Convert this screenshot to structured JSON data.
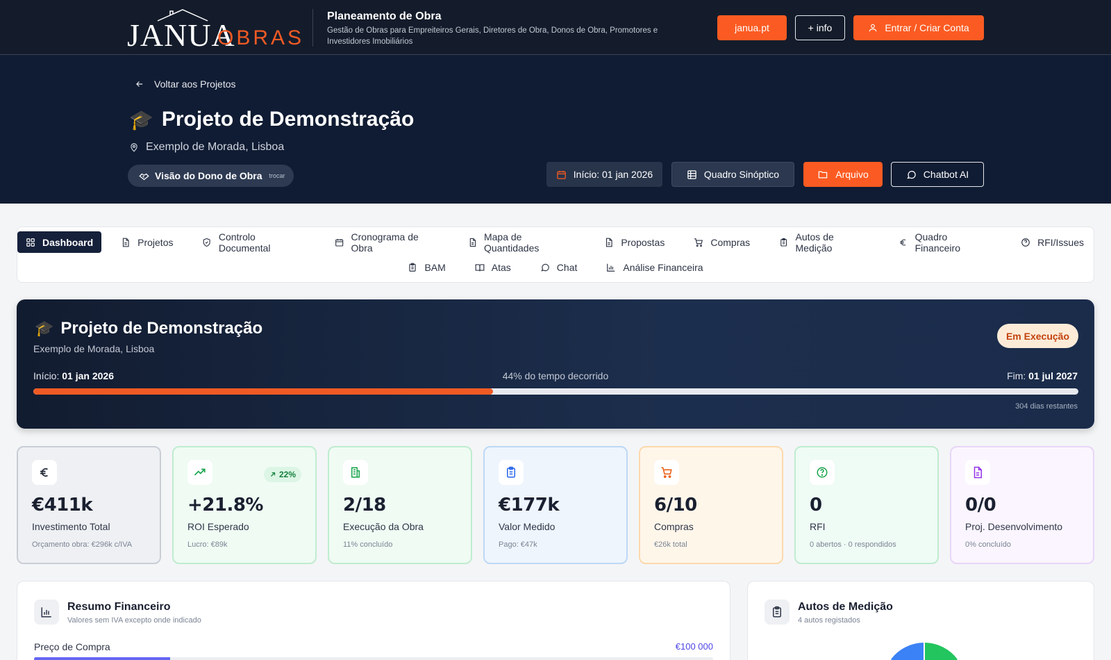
{
  "header": {
    "logo_main": "JANUA",
    "logo_sub": "OBRAS",
    "title": "Planeamento de Obra",
    "subtitle": "Gestão de Obras para Empreiteiros Gerais, Diretores de Obra, Donos de Obra, Promotores e Investidores Imobiliários",
    "btn_site": "janua.pt",
    "btn_info": "+ info",
    "btn_login": "Entrar / Criar Conta",
    "accent": "#fb5b22"
  },
  "hero": {
    "back": "Voltar aos Projetos",
    "emoji": "🎓",
    "title": "Projeto de Demonstração",
    "address": "Exemplo de Morada, Lisboa",
    "view_label": "Visão do Dono de Obra",
    "view_switch": "trocar",
    "start": "Início: 01 jan 2026",
    "quadro": "Quadro Sinóptico",
    "arquivo": "Arquivo",
    "chatbot": "Chatbot AI"
  },
  "nav": {
    "row1": [
      {
        "label": "Dashboard",
        "icon": "grid-icon",
        "active": true
      },
      {
        "label": "Projetos",
        "icon": "file-icon"
      },
      {
        "label": "Controlo Documental",
        "icon": "shield-icon"
      },
      {
        "label": "Cronograma de Obra",
        "icon": "calendar-icon"
      },
      {
        "label": "Mapa de Quantidades",
        "icon": "file-icon"
      },
      {
        "label": "Propostas",
        "icon": "file-icon"
      },
      {
        "label": "Compras",
        "icon": "cart-icon"
      },
      {
        "label": "Autos de Medição",
        "icon": "clipboard-icon"
      },
      {
        "label": "Quadro Financeiro",
        "icon": "euro-icon"
      },
      {
        "label": "RFI/Issues",
        "icon": "help-icon"
      }
    ],
    "row2": [
      {
        "label": "BAM",
        "icon": "clipboard-icon"
      },
      {
        "label": "Atas",
        "icon": "book-icon"
      },
      {
        "label": "Chat",
        "icon": "chat-icon"
      },
      {
        "label": "Análise Financeira",
        "icon": "bar-chart-icon"
      }
    ]
  },
  "project": {
    "emoji": "🎓",
    "title": "Projeto de Demonstração",
    "address": "Exemplo de Morada, Lisboa",
    "status": "Em Execução",
    "start_label": "Início:",
    "start_date": "01 jan 2026",
    "elapsed_text": "44% do tempo decorrido",
    "elapsed_fraction": 0.44,
    "end_label": "Fim:",
    "end_date": "01 jul 2027",
    "remaining": "304 dias restantes"
  },
  "kpis": [
    {
      "value": "€411k",
      "label": "Investimento Total",
      "sub": "Orçamento obra: €296k c/IVA",
      "icon": "euro-icon",
      "color": "#1a2030"
    },
    {
      "value": "+21.8%",
      "label": "ROI Esperado",
      "sub": "Lucro: €89k",
      "badge": "22%",
      "icon": "trending-up-icon",
      "color": "#16a34a"
    },
    {
      "value": "2/18",
      "label": "Execução da Obra",
      "sub": "11% concluído",
      "icon": "building-icon",
      "color": "#16a34a"
    },
    {
      "value": "€177k",
      "label": "Valor Medido",
      "sub": "Pago: €47k",
      "icon": "clipboard-icon",
      "color": "#2563eb"
    },
    {
      "value": "6/10",
      "label": "Compras",
      "sub": "€26k total",
      "icon": "cart-icon",
      "color": "#ea580c"
    },
    {
      "value": "0",
      "label": "RFI",
      "sub": "0 abertos · 0 respondidos",
      "icon": "help-icon",
      "color": "#16a34a"
    },
    {
      "value": "0/0",
      "label": "Proj. Desenvolvimento",
      "sub": "0% concluído",
      "icon": "file-icon",
      "color": "#9333ea"
    }
  ],
  "financial": {
    "title": "Resumo Financeiro",
    "subtitle": "Valores sem IVA excepto onde indicado",
    "row_label": "Preço de Compra",
    "row_value": "€100 000",
    "row_fraction": 0.2
  },
  "measurements": {
    "title": "Autos de Medição",
    "subtitle": "4 autos registados"
  }
}
